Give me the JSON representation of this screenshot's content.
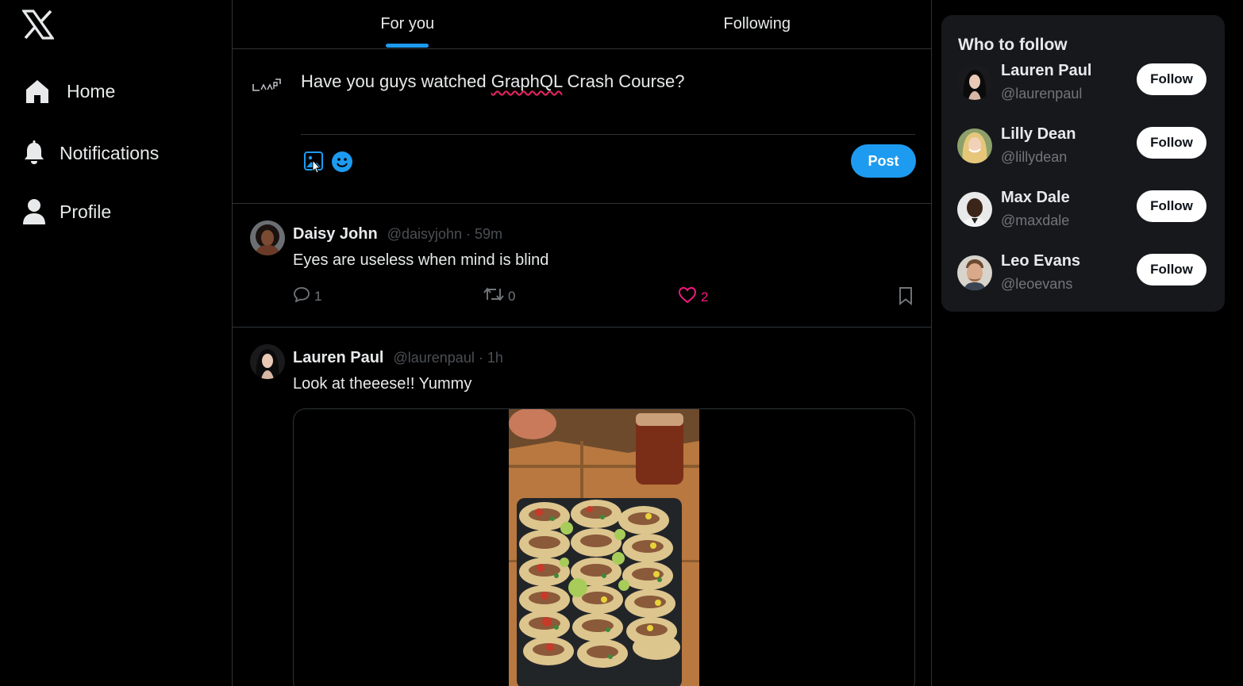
{
  "nav": {
    "logo": "x-logo-icon",
    "items": [
      {
        "label": "Home",
        "icon": "home-icon"
      },
      {
        "label": "Notifications",
        "icon": "bell-icon"
      },
      {
        "label": "Profile",
        "icon": "user-icon"
      }
    ]
  },
  "tabs": [
    {
      "label": "For you",
      "active": true
    },
    {
      "label": "Following",
      "active": false
    }
  ],
  "composer": {
    "text_before": "Have you guys watched ",
    "text_misspelled": "GraphQL",
    "text_after": " Crash Course?",
    "post_label": "Post"
  },
  "posts": [
    {
      "name": "Daisy John",
      "handle": "@daisyjohn",
      "separator": "·",
      "time": "59m",
      "text": "Eyes are useless when mind is blind",
      "replies": "1",
      "reposts": "0",
      "likes": "2"
    },
    {
      "name": "Lauren Paul",
      "handle": "@laurenpaul",
      "separator": "·",
      "time": "1h",
      "text": "Look at theeese!! Yummy"
    }
  ],
  "who_to_follow": {
    "title": "Who to follow",
    "users": [
      {
        "name": "Lauren Paul",
        "handle": "@laurenpaul",
        "button": "Follow"
      },
      {
        "name": "Lilly Dean",
        "handle": "@lillydean",
        "button": "Follow"
      },
      {
        "name": "Max Dale",
        "handle": "@maxdale",
        "button": "Follow"
      },
      {
        "name": "Leo Evans",
        "handle": "@leoevans",
        "button": "Follow"
      }
    ]
  },
  "colors": {
    "accent": "#1d9bf0",
    "like": "#f91880",
    "background": "#000000",
    "card": "#16181c"
  }
}
